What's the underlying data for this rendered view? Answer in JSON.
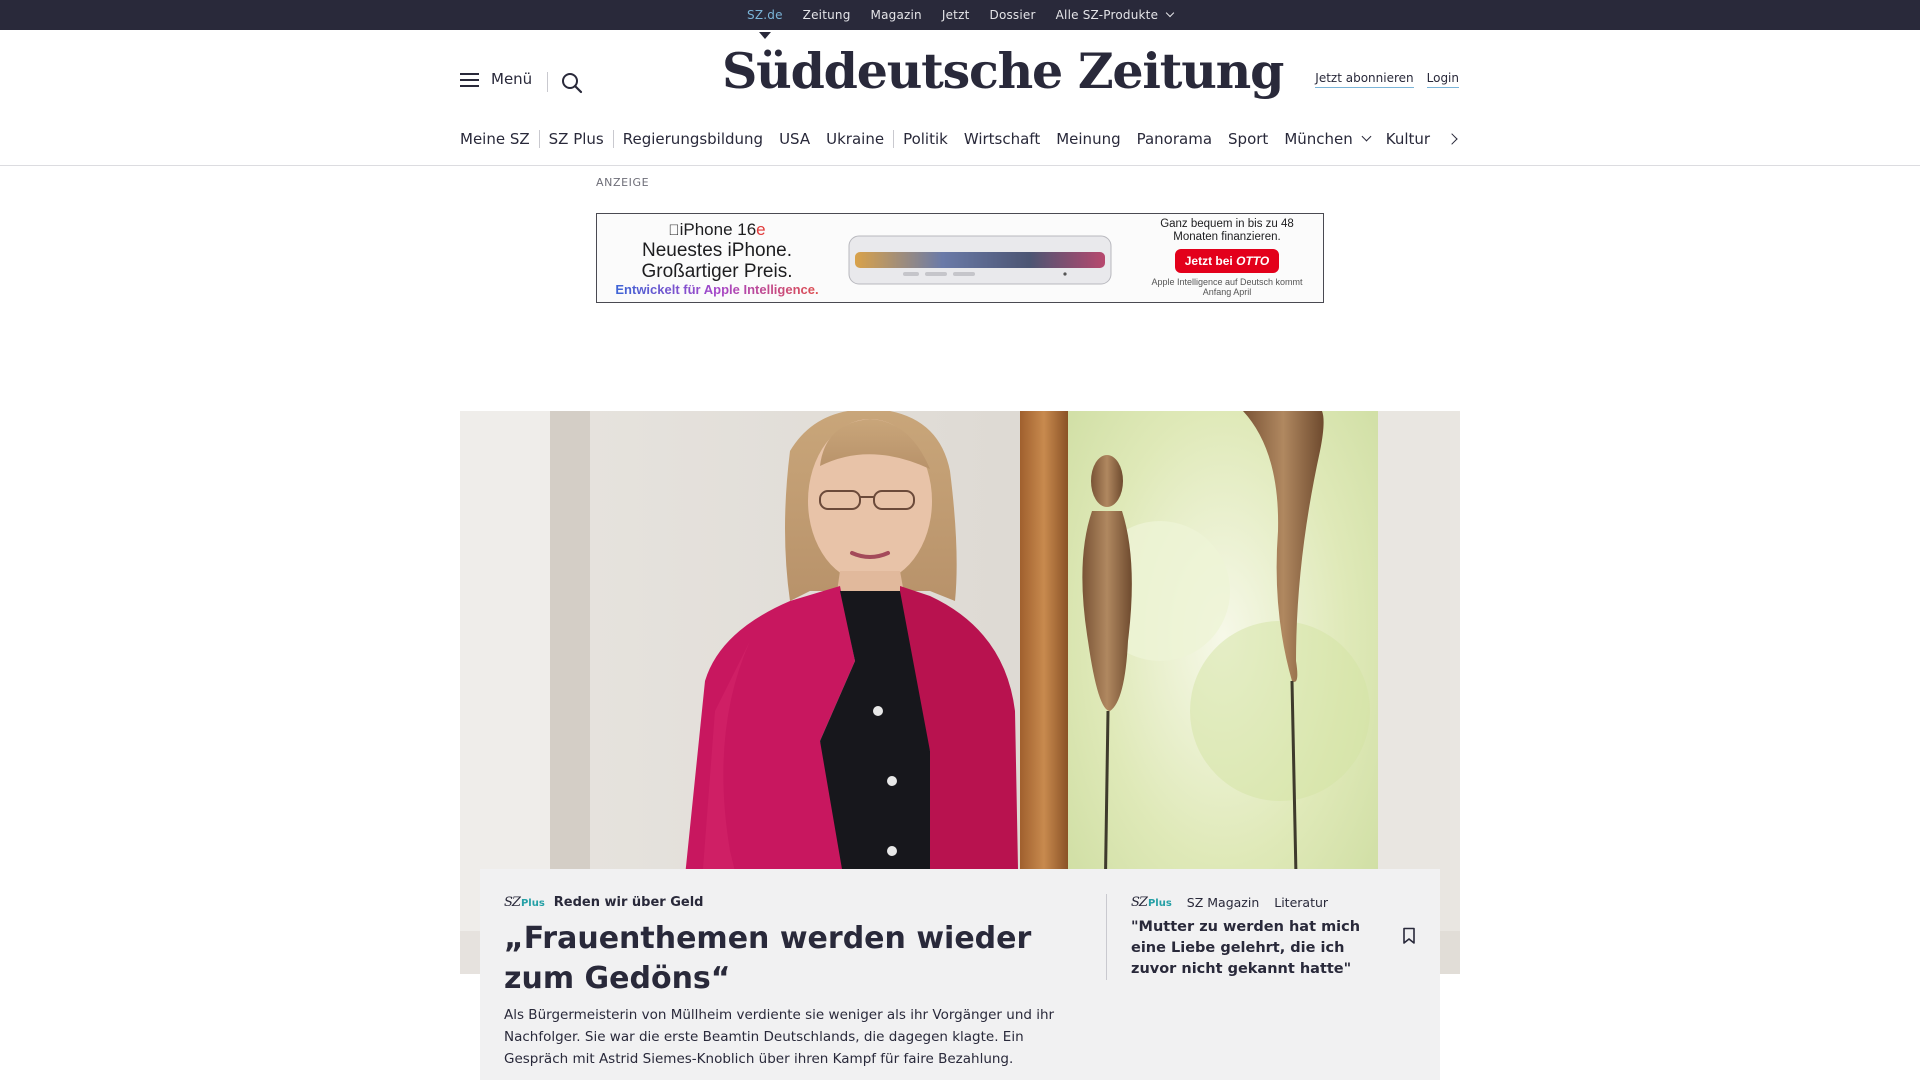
{
  "topbar": {
    "items": [
      {
        "label": "SZ.de",
        "active": true
      },
      {
        "label": "Zeitung"
      },
      {
        "label": "Magazin"
      },
      {
        "label": "Jetzt"
      },
      {
        "label": "Dossier"
      },
      {
        "label": "Alle SZ-Produkte"
      }
    ]
  },
  "header": {
    "menu_label": "Menü",
    "logo_text": "Süddeutsche Zeitung",
    "subscribe_label": "Jetzt abonnieren",
    "login_label": "Login"
  },
  "nav": {
    "items": [
      "Meine SZ",
      "SZ Plus",
      "Regierungsbildung",
      "USA",
      "Ukraine",
      "Politik",
      "Wirtschaft",
      "Meinung",
      "Panorama",
      "Sport",
      "München",
      "Kultur"
    ]
  },
  "ad": {
    "label": "ANZEIGE",
    "product": "iPhone 16",
    "product_suffix": "e",
    "line1": "Neuestes iPhone.",
    "line2": "Großartiger Preis.",
    "line3": "Entwickelt für Apple Intelligence.",
    "financing": "Ganz bequem in bis zu 48 Monaten finanzieren.",
    "cta_prefix": "Jetzt bei",
    "cta_brand": "OTTO",
    "note": "Apple Intelligence auf Deutsch kommt Anfang April"
  },
  "teaser": {
    "badge_sz": "SZ",
    "badge_plus": "Plus",
    "kicker": "Reden wir über Geld",
    "headline": "„Frauenthemen werden wieder zum Gedöns“",
    "text": "Als Bürgermeisterin von Müllheim verdiente sie weniger als ihr Vorgänger und ihr Nachfolger. Sie war die erste Beamtin Deutschlands, die dagegen klagte. Ein Gespräch mit Astrid Siemes-Knoblich über ihren Kampf für faire Bezahlung."
  },
  "side_teaser": {
    "badge_sz": "SZ",
    "badge_plus": "Plus",
    "section": "SZ Magazin",
    "category": "Literatur",
    "title": "\"Mutter zu werden hat mich eine Liebe gelehrt, die ich zuvor nicht gekannt hatte\""
  },
  "colors": {
    "topbar_bg": "#29293a",
    "accent_link": "#7ab4d8",
    "plus_teal": "#25a0a6",
    "card_bg": "#f1f1f2",
    "jacket": "#c8175f"
  },
  "icons": [
    "hamburger-icon",
    "search-icon",
    "chevron-down-icon",
    "chevron-right-icon",
    "bookmark-icon",
    "apple-logo-icon"
  ]
}
